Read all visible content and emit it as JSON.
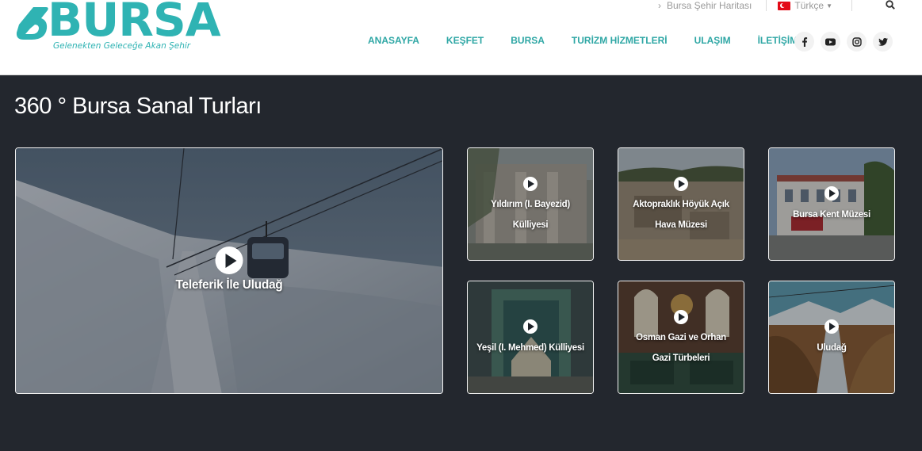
{
  "brand": {
    "logo_text": "BURSA",
    "tagline": "Gelenekten Geleceğe Akan Şehir",
    "color": "#2fb3b3"
  },
  "topbar": {
    "city_map_label": "Bursa Şehir Haritası",
    "language_label": "Türkçe",
    "search_icon": "search-icon"
  },
  "nav": {
    "items": [
      "ANASAYFA",
      "KEŞFET",
      "BURSA",
      "TURİZM HİZMETLERİ",
      "ULAŞIM",
      "İLETİŞİM"
    ]
  },
  "social": [
    "facebook-icon",
    "youtube-icon",
    "instagram-icon",
    "twitter-icon"
  ],
  "page": {
    "title": "360 ° Bursa Sanal Turları"
  },
  "tours": [
    {
      "label": "Teleferik İle Uludağ"
    },
    {
      "label_line1": "Yıldırım (I. Bayezid)",
      "label_line2": "Külliyesi"
    },
    {
      "label_line1": "Aktopraklık Höyük Açık",
      "label_line2": "Hava Müzesi"
    },
    {
      "label": "Bursa Kent Müzesi"
    },
    {
      "label": "Yeşil (I. Mehmed) Külliyesi"
    },
    {
      "label_line1": "Osman Gazi ve Orhan",
      "label_line2": "Gazi Türbeleri"
    },
    {
      "label": "Uludağ"
    }
  ],
  "colors": {
    "background": "#23272e",
    "nav_text": "#2fa7a5",
    "header_bg": "#ffffff"
  }
}
